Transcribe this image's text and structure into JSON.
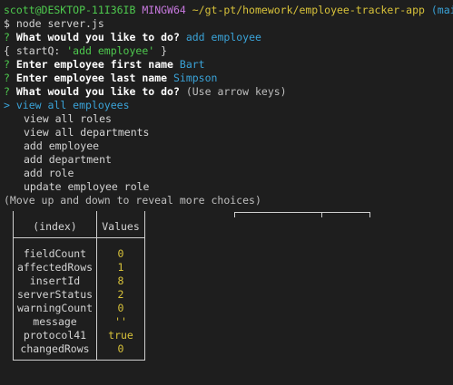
{
  "prompt": {
    "user_host": "scott@DESKTOP-11I36IB",
    "shell": "MINGW64",
    "path": "~/gt-pt/homework/employee-tracker-app",
    "branch": "(main)"
  },
  "lines": {
    "cmd": "$ node server.js",
    "q1_label": "What would you like to do?",
    "q1_answer": "add employee",
    "obj_open": "{ startQ: ",
    "obj_val": "'add employee'",
    "obj_close": " }",
    "q2_label": "Enter employee first name",
    "q2_answer": "Bart",
    "q3_label": "Enter employee last name",
    "q3_answer": "Simpson",
    "q4_label": "What would you like to do?",
    "q4_hint": "(Use arrow keys)",
    "q_mark": "?",
    "pointer": ">",
    "more_hint": "(Move up and down to reveal more choices)"
  },
  "menu": [
    "view all employees",
    "view all roles",
    "view all departments",
    "add employee",
    "add department",
    "add role",
    "update employee role"
  ],
  "table": {
    "headers": [
      "(index)",
      "Values"
    ],
    "rows": [
      {
        "key": "fieldCount",
        "value": "0"
      },
      {
        "key": "affectedRows",
        "value": "1"
      },
      {
        "key": "insertId",
        "value": "8"
      },
      {
        "key": "serverStatus",
        "value": "2"
      },
      {
        "key": "warningCount",
        "value": "0"
      },
      {
        "key": "message",
        "value": "''"
      },
      {
        "key": "protocol41",
        "value": "true"
      },
      {
        "key": "changedRows",
        "value": "0"
      }
    ]
  },
  "colors": {
    "background": "#1e1e1e",
    "green": "#4ec94e",
    "magenta": "#c678dd",
    "yellow": "#d8c23a",
    "cyan": "#3aa3d8"
  }
}
